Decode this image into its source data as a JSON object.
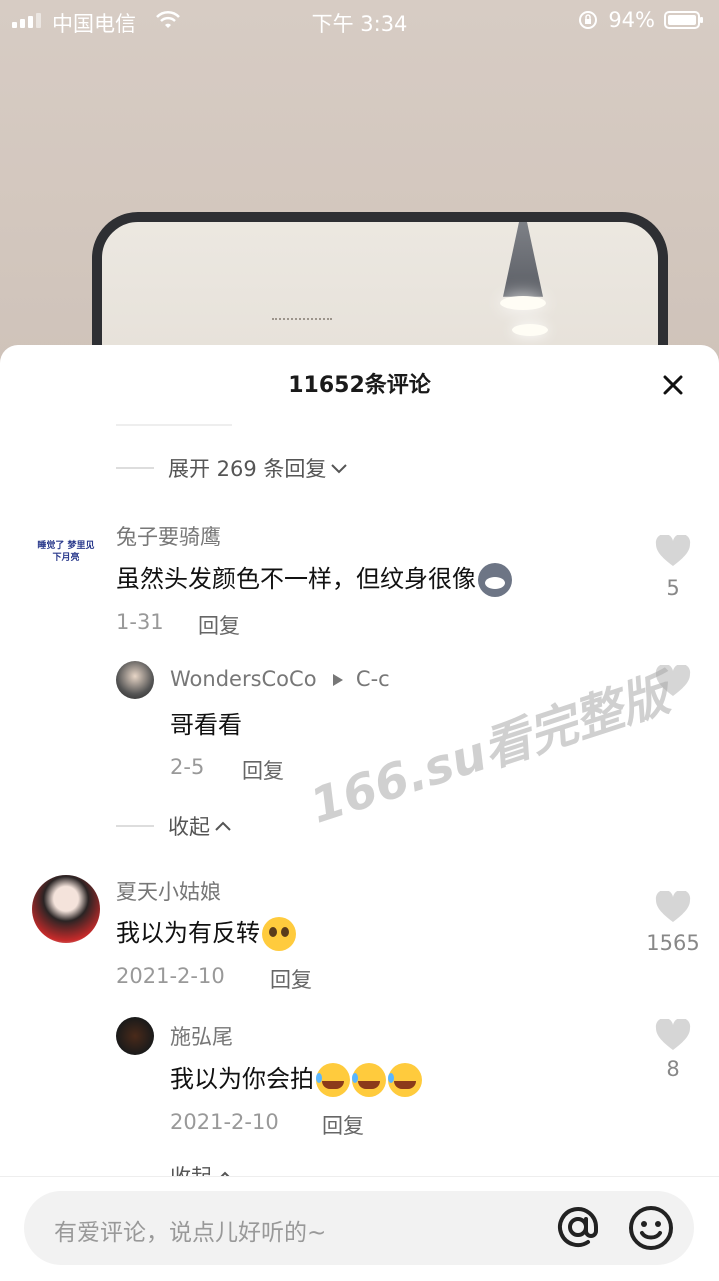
{
  "status": {
    "carrier": "中国电信",
    "time": "下午 3:34",
    "battery": "94%"
  },
  "sheet": {
    "title": "11652条评论",
    "expand_label": "展开 269 条回复",
    "comments": [
      {
        "user": "兔子要骑鹰",
        "text": "虽然头发颜色不一样，但纹身很像",
        "date": "1-31",
        "reply_label": "回复",
        "likes": "5"
      },
      {
        "user": "WondersCoCo",
        "reply_to": "C-c",
        "text": "哥看看",
        "date": "2-5",
        "reply_label": "回复"
      },
      {
        "user": "夏天小姑娘",
        "text": "我以为有反转",
        "date": "2021-2-10",
        "reply_label": "回复",
        "likes": "1565"
      },
      {
        "user": "施弘尾",
        "text": "我以为你会拍",
        "date": "2021-2-10",
        "reply_label": "回复",
        "likes": "8"
      }
    ],
    "collapse_label": "收起",
    "collapse_label_2": "收起"
  },
  "avatar_text": "睡觉了 梦里见 下月亮",
  "watermark": "166.su看完整版",
  "input": {
    "placeholder": "有爱评论，说点儿好听的~"
  },
  "icons": [
    "signal-icon",
    "wifi-icon",
    "orientation-lock-icon",
    "battery-icon",
    "close-icon",
    "chevron-down-icon",
    "chevron-up-icon",
    "heart-icon",
    "at-icon",
    "emoji-icon",
    "play-icon"
  ],
  "colors": {
    "sheet_bg": "#ffffff",
    "text_primary": "#111111",
    "text_secondary": "#999999",
    "like_gray": "#d6d6d6"
  }
}
